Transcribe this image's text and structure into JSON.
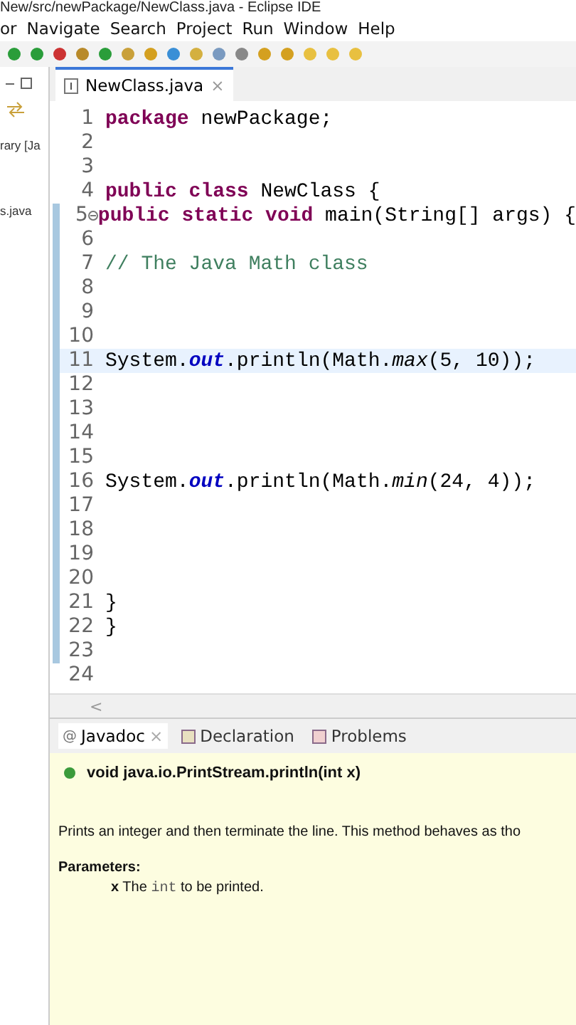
{
  "window": {
    "title": "New/src/newPackage/NewClass.java - Eclipse IDE"
  },
  "menu": [
    "or",
    "Navigate",
    "Search",
    "Project",
    "Run",
    "Window",
    "Help"
  ],
  "left_panel": {
    "items": [
      "rary [Ja",
      "s.java"
    ]
  },
  "editor": {
    "tab": {
      "label": "NewClass.java",
      "close": "×",
      "selected": true
    },
    "lines": [
      {
        "number": "1",
        "segments": [
          {
            "kind": "keyword",
            "text": "package"
          },
          {
            "kind": "plain",
            "text": " newPackage;"
          }
        ]
      },
      {
        "number": "2"
      },
      {
        "number": "3"
      },
      {
        "number": "4",
        "segments": [
          {
            "kind": "keyword",
            "text": "public class"
          },
          {
            "kind": "plain",
            "text": " NewClass {"
          }
        ]
      },
      {
        "number": "5",
        "fold": true,
        "segments": [
          {
            "kind": "keyword",
            "text": "public static void"
          },
          {
            "kind": "plain",
            "text": " main(String[] args) {"
          }
        ]
      },
      {
        "number": "6"
      },
      {
        "number": "7",
        "segments": [
          {
            "kind": "comment",
            "text": "// The Java Math class"
          }
        ]
      },
      {
        "number": "8"
      },
      {
        "number": "9"
      },
      {
        "number": "10"
      },
      {
        "number": "11",
        "current": true,
        "segments": [
          {
            "kind": "plain",
            "text": "System."
          },
          {
            "kind": "field",
            "text": "out"
          },
          {
            "kind": "plain",
            "text": ".println(Math."
          },
          {
            "kind": "method",
            "text": "max"
          },
          {
            "kind": "plain",
            "text": "(5, 10));"
          }
        ]
      },
      {
        "number": "12"
      },
      {
        "number": "13"
      },
      {
        "number": "14"
      },
      {
        "number": "15"
      },
      {
        "number": "16",
        "segments": [
          {
            "kind": "plain",
            "text": "System."
          },
          {
            "kind": "field",
            "text": "out"
          },
          {
            "kind": "plain",
            "text": ".println(Math."
          },
          {
            "kind": "method",
            "text": "min"
          },
          {
            "kind": "plain",
            "text": "(24, 4));"
          }
        ]
      },
      {
        "number": "17"
      },
      {
        "number": "18"
      },
      {
        "number": "19"
      },
      {
        "number": "20"
      },
      {
        "number": "21",
        "segments": [
          {
            "kind": "plain",
            "text": "}"
          }
        ]
      },
      {
        "number": "22",
        "segments": [
          {
            "kind": "plain",
            "text": "}"
          }
        ]
      },
      {
        "number": "23"
      },
      {
        "number": "24"
      }
    ],
    "scroll_left": "<"
  },
  "bottom_panel": {
    "tabs": [
      {
        "label": "Javadoc",
        "icon": "@",
        "close": "×",
        "selected": true
      },
      {
        "label": "Declaration",
        "selected": false
      },
      {
        "label": "Problems",
        "selected": false
      }
    ],
    "signature": "void java.io.PrintStream.println(int x)",
    "description": "Prints an integer and then terminate the line. This method behaves as tho",
    "parameters_heading": "Parameters:",
    "parameter": {
      "name": "x",
      "segments": [
        {
          "kind": "text",
          "text": "The "
        },
        {
          "kind": "code",
          "text": "int"
        },
        {
          "kind": "text",
          "text": " to be printed."
        }
      ]
    }
  }
}
